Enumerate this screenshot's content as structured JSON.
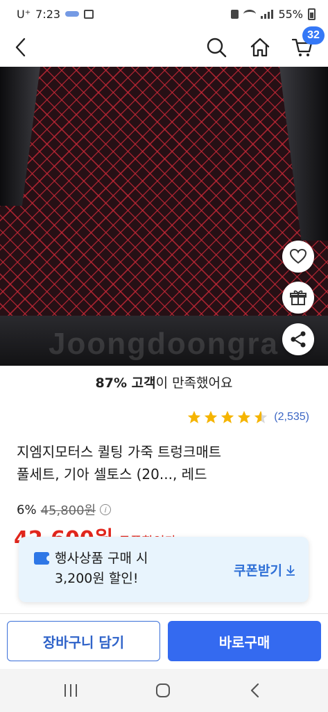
{
  "status_bar": {
    "carrier": "U⁺",
    "time": "7:23",
    "battery": "55%"
  },
  "header": {
    "cart_count": "32"
  },
  "hero": {
    "watermark": "Joongdoongra"
  },
  "satisfaction": {
    "percent": "87% 고객",
    "rest": "이 만족했어요"
  },
  "rating": {
    "stars": 4.5,
    "count": "(2,535)",
    "star_color": "#f5b400"
  },
  "product": {
    "title_line1": "지엠지모터스 퀼팅 가죽 트렁크매트",
    "title_line2": "풀세트, 기아 셀토스 (20..., 레드"
  },
  "price": {
    "discount": "6%",
    "original": "45,800원",
    "sale": "42,600원",
    "coupon_label": "쿠폰할인가",
    "sale_color": "#e1261c"
  },
  "coupon_popup": {
    "line1": "행사상품 구매 시",
    "line2": "3,200원 할인!",
    "action": "쿠폰받기"
  },
  "actions": {
    "cart_label": "장바구니 담기",
    "buy_label": "바로구매",
    "accent": "#346af0"
  }
}
